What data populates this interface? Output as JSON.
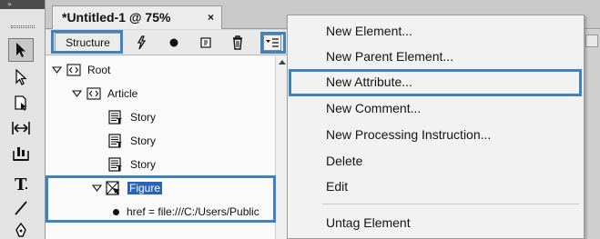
{
  "tools_panel": {
    "collapse_glyph": "»",
    "tools": [
      {
        "name": "selection-tool-icon",
        "selected": true
      },
      {
        "name": "direct-selection-tool-icon",
        "selected": false
      },
      {
        "name": "page-tool-icon",
        "selected": false
      },
      {
        "name": "gap-tool-icon",
        "selected": false
      },
      {
        "name": "content-collector-icon",
        "selected": false
      },
      {
        "name": "type-tool-icon",
        "selected": false
      },
      {
        "name": "line-tool-icon",
        "selected": false
      },
      {
        "name": "pen-tool-icon",
        "selected": false
      }
    ]
  },
  "document_tab": {
    "title": "*Untitled-1 @ 75%",
    "close_glyph": "×"
  },
  "structure_panel": {
    "tab_label": "Structure",
    "toolbar_icons": [
      "script-lightning-icon",
      "add-attribute-dot-icon",
      "tag-marker-icon",
      "delete-trash-icon",
      "panel-menu-icon"
    ],
    "tree": [
      {
        "label": "Root",
        "depth": 0,
        "expanded": true,
        "icon": "xml-element-icon"
      },
      {
        "label": "Article",
        "depth": 1,
        "expanded": true,
        "icon": "xml-element-icon"
      },
      {
        "label": "Story",
        "depth": 2,
        "icon": "text-story-icon"
      },
      {
        "label": "Story",
        "depth": 2,
        "icon": "text-story-icon"
      },
      {
        "label": "Story",
        "depth": 2,
        "icon": "text-story-icon"
      },
      {
        "label": "Figure",
        "depth": 1,
        "expanded": true,
        "selected": true,
        "icon": "graphic-frame-icon"
      },
      {
        "label": "href = file:///C:/Users/Public",
        "depth": 2,
        "attribute": true
      }
    ]
  },
  "context_menu": {
    "items": [
      {
        "label": "New Element..."
      },
      {
        "label": "New Parent Element..."
      },
      {
        "label": "New Attribute...",
        "highlighted": true
      },
      {
        "label": "New Comment..."
      },
      {
        "label": "New Processing Instruction..."
      },
      {
        "label": "Delete"
      },
      {
        "label": "Edit"
      },
      {
        "label": "Untag Element"
      }
    ]
  },
  "colors": {
    "highlight_box": "#3d83c2",
    "selection": "#2a63b8"
  }
}
